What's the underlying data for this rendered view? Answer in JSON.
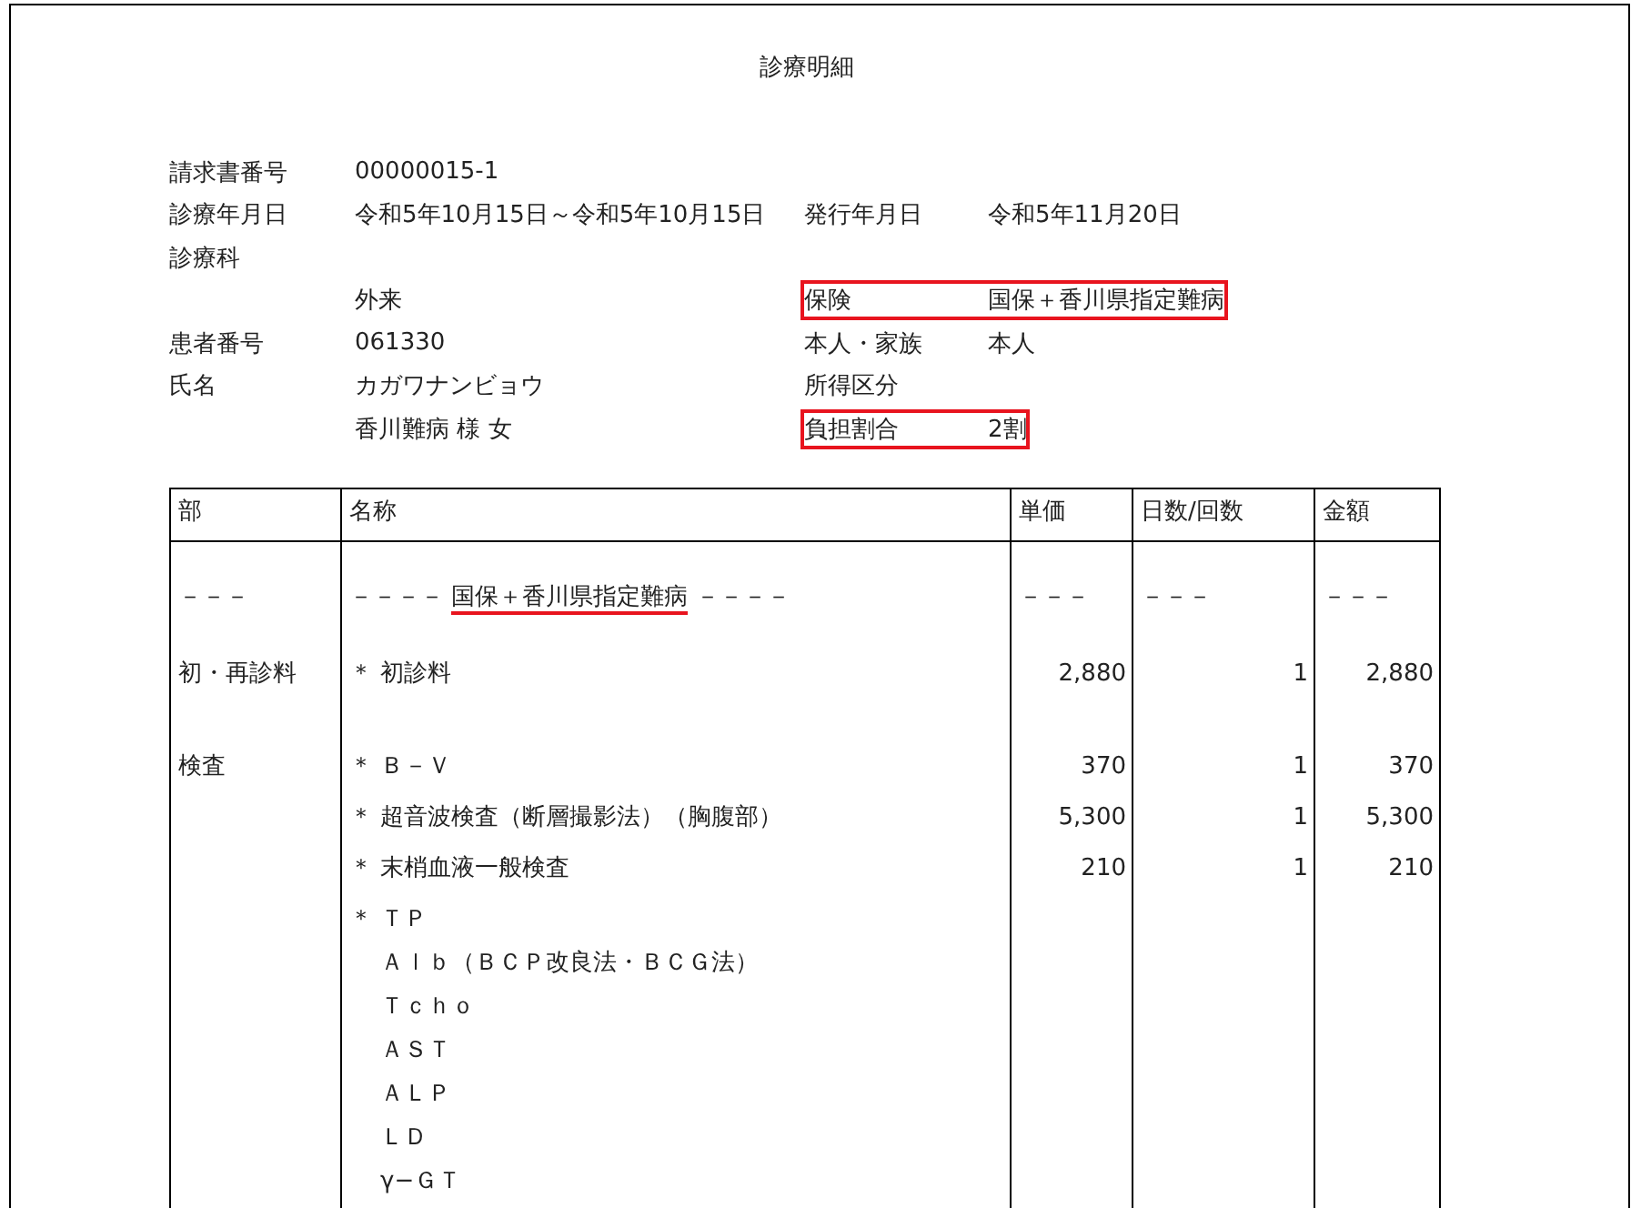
{
  "title": "診療明細",
  "info": {
    "rows": [
      {
        "label": "請求書番号",
        "value": "00000015-1",
        "highlighted": false
      },
      {
        "label": "診療年月日",
        "value": "令和5年10月15日～令和5年10月15日",
        "label_2": "発行年月日",
        "value_2": "令和5年11月20日",
        "highlighted": false
      },
      {
        "label": "診療科",
        "highlighted": false
      },
      {
        "value": "外来",
        "label_2": "保険",
        "value_2": "国保＋香川県指定難病",
        "highlighted": true
      },
      {
        "label": "患者番号",
        "value": "061330",
        "label_2": "本人・家族",
        "value_2": "本人",
        "highlighted": false
      },
      {
        "label": "氏名",
        "value": "カガワナンビョウ",
        "label_2": "所得区分",
        "highlighted": false
      },
      {
        "value": "香川難病 様 女",
        "label_2": "負担割合",
        "value_2": "2割",
        "highlighted": true
      }
    ]
  },
  "table": {
    "columns": [
      "部",
      "名称",
      "単価",
      "日数/回数",
      "金額"
    ],
    "rows": [
      {
        "kind": "insurance",
        "section": "－－－",
        "name_lead": "－－－－",
        "name": "国保＋香川県指定難病",
        "name_trail": "－－－－",
        "underlined": true,
        "unit_price": "－－－",
        "count": "－－－",
        "amount": "－－－"
      },
      {
        "kind": "group",
        "section": "初・再診料",
        "items": [
          {
            "mark": "＊",
            "lines": [
              "初診料"
            ],
            "unit_price": "2,880",
            "count": "1",
            "amount": "2,880"
          }
        ]
      },
      {
        "kind": "group",
        "section": "検査",
        "items": [
          {
            "mark": "＊",
            "lines": [
              "Ｂ－Ｖ"
            ],
            "unit_price": "370",
            "count": "1",
            "amount": "370"
          },
          {
            "mark": "＊",
            "lines": [
              "超音波検査（断層撮影法）（胸腹部）"
            ],
            "unit_price": "5,300",
            "count": "1",
            "amount": "5,300"
          },
          {
            "mark": "＊",
            "lines": [
              "末梢血液一般検査"
            ],
            "unit_price": "210",
            "count": "1",
            "amount": "210"
          },
          {
            "mark": "＊",
            "lines": [
              "ＴＰ",
              "Ａｌｂ（ＢＣＰ改良法・ＢＣＧ法）",
              "Ｔｃｈｏ",
              "ＡＳＴ",
              "ＡＬＰ",
              "ＬＤ",
              "γ−ＧＴ"
            ]
          }
        ]
      }
    ]
  }
}
